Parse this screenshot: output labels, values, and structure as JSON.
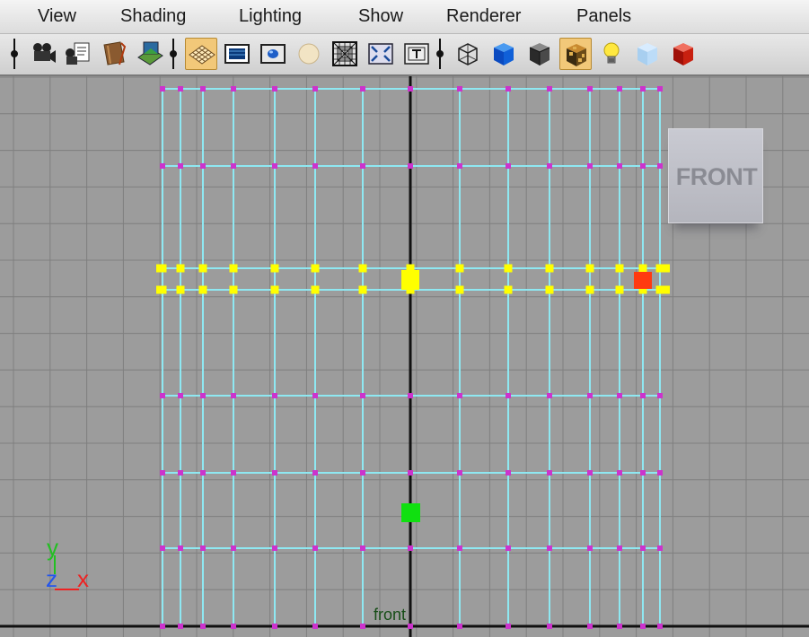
{
  "menubar": {
    "items": [
      "View",
      "Shading",
      "Lighting",
      "Show",
      "Renderer",
      "Panels"
    ]
  },
  "toolbar": {
    "groups": [
      [
        {
          "icon": "camera-icon",
          "active": false
        },
        {
          "icon": "camera-attributes-icon",
          "active": false
        },
        {
          "icon": "bookmark-icon",
          "active": false
        },
        {
          "icon": "image-plane-icon",
          "active": false
        }
      ],
      [
        {
          "icon": "grid-icon",
          "active": true
        },
        {
          "icon": "film-gate-icon",
          "active": false
        },
        {
          "icon": "resolution-gate-icon",
          "active": false
        },
        {
          "icon": "gate-mask-icon",
          "active": false
        },
        {
          "icon": "field-chart-icon",
          "active": false
        },
        {
          "icon": "safe-action-icon",
          "active": false
        },
        {
          "icon": "safe-title-icon",
          "active": false
        }
      ],
      [
        {
          "icon": "wireframe-icon",
          "active": false
        },
        {
          "icon": "smooth-shade-icon",
          "active": false
        },
        {
          "icon": "flat-shade-icon",
          "active": false
        },
        {
          "icon": "textured-icon",
          "active": true
        },
        {
          "icon": "use-all-lights-icon",
          "active": false
        },
        {
          "icon": "xray-icon",
          "active": false
        },
        {
          "icon": "shaded-wireframe-icon",
          "active": false
        }
      ]
    ]
  },
  "viewport": {
    "camera_name": "front",
    "view_cube_label": "FRONT",
    "axis": {
      "y": "y",
      "z": "z",
      "x": "x"
    },
    "colors": {
      "background": "#9c9c9c",
      "grid_line": "#7f7f7f",
      "mesh_edge": "#8ee8f2",
      "vertex": "#cc33cc",
      "selected_vertex": "#ffff00",
      "lead_selected_vertex": "#ff3a10",
      "pivot_marker": "#10e010",
      "axis_y": "#22c022",
      "axis_z": "#2255ee",
      "axis_x": "#ee2222"
    }
  }
}
